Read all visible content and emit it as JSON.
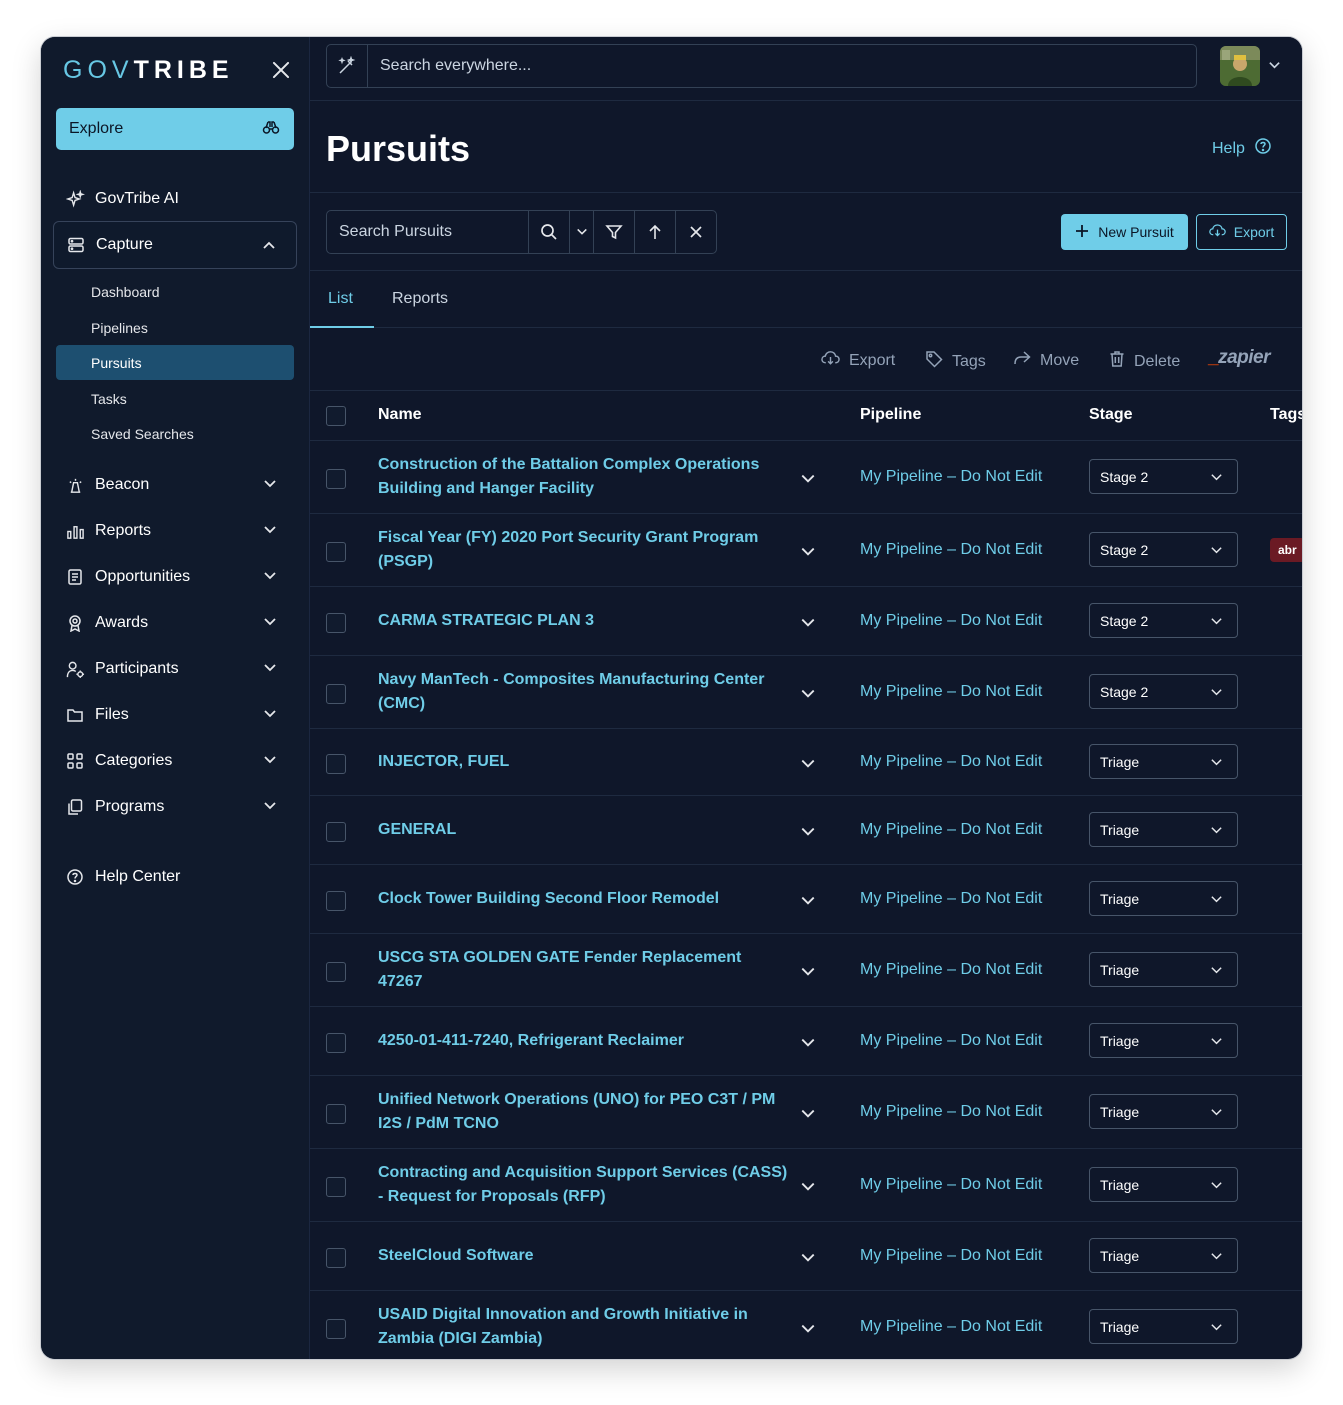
{
  "sidebar": {
    "logo_gov": "GOV",
    "logo_tribe": "TRIBE",
    "explore_label": "Explore",
    "govtribe_ai_label": "GovTribe AI",
    "capture_label": "Capture",
    "capture_children": [
      "Dashboard",
      "Pipelines",
      "Pursuits",
      "Tasks",
      "Saved Searches"
    ],
    "sections": [
      "Beacon",
      "Reports",
      "Opportunities",
      "Awards",
      "Participants",
      "Files",
      "Categories",
      "Programs"
    ],
    "help_center_label": "Help Center"
  },
  "topbar": {
    "search_placeholder": "Search everywhere..."
  },
  "page": {
    "title": "Pursuits",
    "help_label": "Help",
    "search_pursuits_placeholder": "Search Pursuits",
    "new_pursuit_label": "New Pursuit",
    "export_label": "Export"
  },
  "tabs": [
    "List",
    "Reports"
  ],
  "actions": {
    "export": "Export",
    "tags": "Tags",
    "move": "Move",
    "delete": "Delete",
    "zapier": "zapier"
  },
  "table": {
    "headers": [
      "Name",
      "Pipeline",
      "Stage",
      "Tags"
    ],
    "rows": [
      {
        "name": "Construction of the Battalion Complex Operations Building and Hanger Facility",
        "pipeline": "My Pipeline – Do Not Edit",
        "stage": "Stage 2"
      },
      {
        "name": "Fiscal Year (FY) 2020 Port Security Grant Program (PSGP)",
        "pipeline": "My Pipeline – Do Not Edit",
        "stage": "Stage 2",
        "tag": "abr"
      },
      {
        "name": "CARMA STRATEGIC PLAN 3",
        "pipeline": "My Pipeline – Do Not Edit",
        "stage": "Stage 2"
      },
      {
        "name": "Navy ManTech - Composites Manufacturing Center (CMC)",
        "pipeline": "My Pipeline – Do Not Edit",
        "stage": "Stage 2"
      },
      {
        "name": "INJECTOR, FUEL",
        "pipeline": "My Pipeline – Do Not Edit",
        "stage": "Triage"
      },
      {
        "name": "GENERAL",
        "pipeline": "My Pipeline – Do Not Edit",
        "stage": "Triage"
      },
      {
        "name": "Clock Tower Building Second Floor Remodel",
        "pipeline": "My Pipeline – Do Not Edit",
        "stage": "Triage"
      },
      {
        "name": "USCG STA GOLDEN GATE Fender Replacement 47267",
        "pipeline": "My Pipeline – Do Not Edit",
        "stage": "Triage"
      },
      {
        "name": "4250-01-411-7240, Refrigerant Reclaimer",
        "pipeline": "My Pipeline – Do Not Edit",
        "stage": "Triage"
      },
      {
        "name": "Unified Network Operations (UNO) for PEO C3T / PM I2S / PdM TCNO",
        "pipeline": "My Pipeline – Do Not Edit",
        "stage": "Triage"
      },
      {
        "name": "Contracting and Acquisition Support Services (CASS) - Request for Proposals (RFP)",
        "pipeline": "My Pipeline – Do Not Edit",
        "stage": "Triage"
      },
      {
        "name": "SteelCloud Software",
        "pipeline": "My Pipeline – Do Not Edit",
        "stage": "Triage"
      },
      {
        "name": "USAID Digital Innovation and Growth Initiative in Zambia (DIGI Zambia)",
        "pipeline": "My Pipeline – Do Not Edit",
        "stage": "Triage"
      }
    ]
  },
  "colors": {
    "background": "#0f172a",
    "accent": "#6fcde8",
    "active_nav": "#1d4f70",
    "tag_badge": "#6b1a24"
  }
}
